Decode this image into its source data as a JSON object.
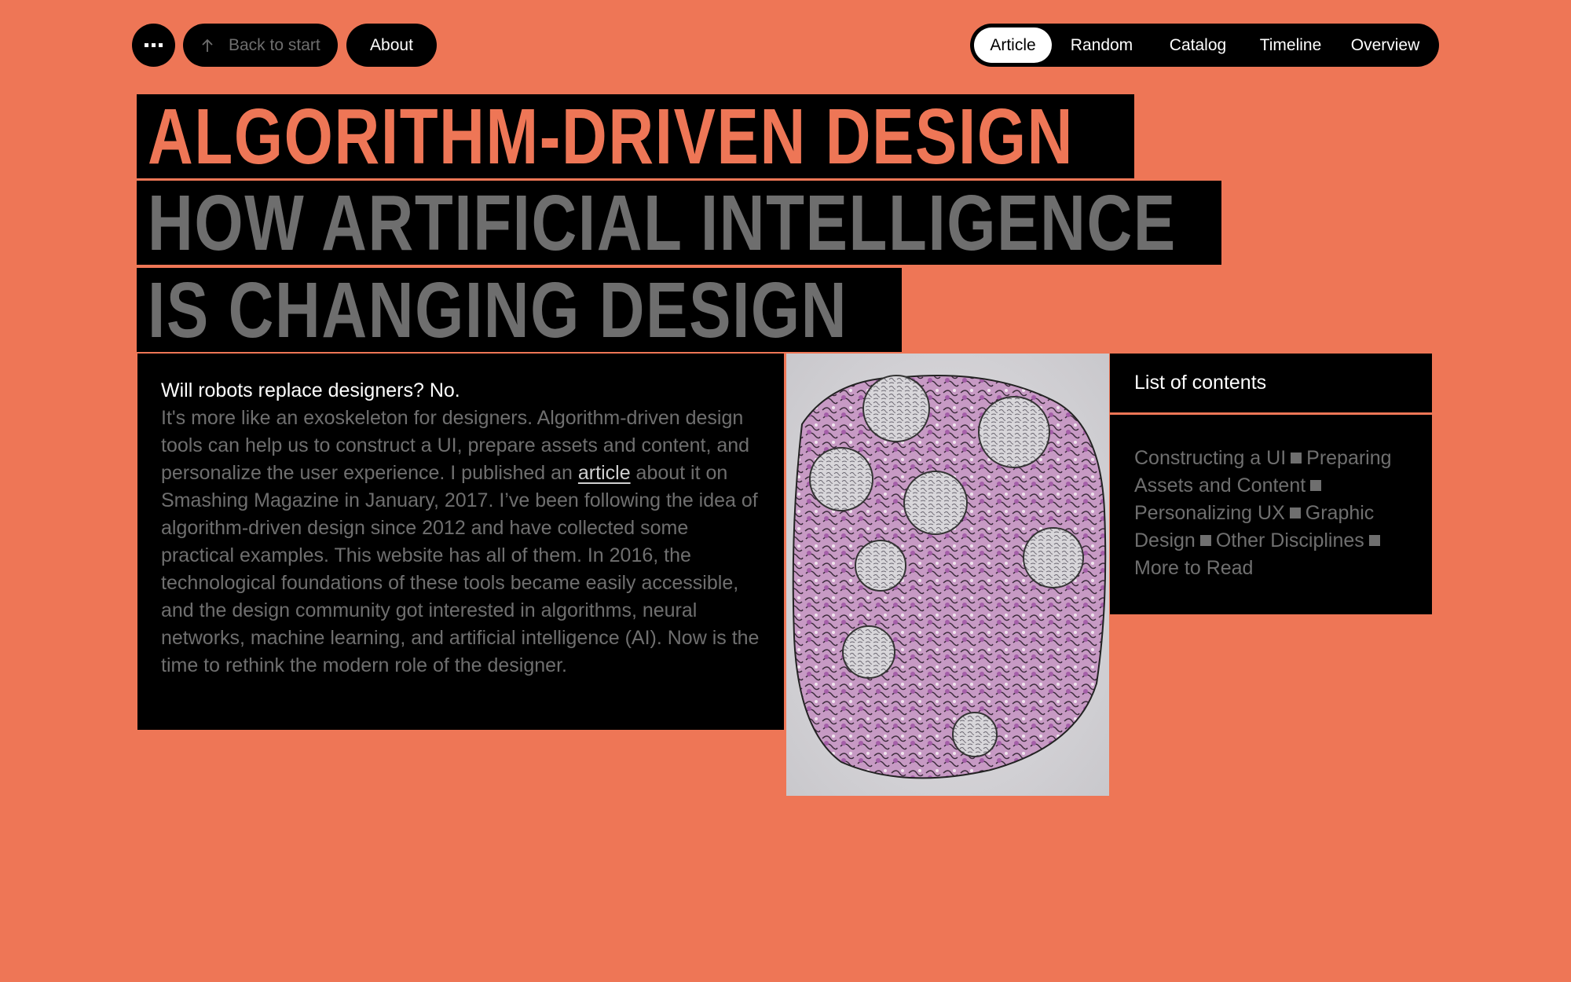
{
  "header": {
    "menu_icon": "more-dots-icon",
    "back_label": "Back to start",
    "back_icon": "arrow-up-icon",
    "about_label": "About",
    "nav": [
      {
        "label": "Article",
        "active": true
      },
      {
        "label": "Random",
        "active": false
      },
      {
        "label": "Catalog",
        "active": false
      },
      {
        "label": "Timeline",
        "active": false
      },
      {
        "label": "Overview",
        "active": false
      }
    ]
  },
  "title": {
    "line1": "ALGORITHM-DRIVEN DESIGN",
    "line2": "HOW ARTIFICIAL INTELLIGENCE",
    "line3": "IS CHANGING DESIGN"
  },
  "intro": {
    "lead": "Will robots replace designers? No.",
    "text_before_link": "It's more like an exoskeleton for designers. Algorithm-driven design tools can help us to construct a UI, prepare assets and content, and personalize the user experience. I published an ",
    "link_label": "article",
    "text_after_link": " about it on Smashing Magazine in January, 2017. I’ve been following the idea of algorithm-driven design since 2012 and have collected some practical examples. This website has all of them. In 2016, the technological foundations of these tools became easily accessible, and the design community got interested in algorithms, neural networks, machine learning, and artificial intelligence (AI). Now is the time to rethink the modern role of the designer."
  },
  "figure": {
    "description": "Algorithmically stylized purple and grey organic cell-like illustration"
  },
  "toc": {
    "heading": "List of contents",
    "items": [
      "Constructing a UI",
      "Preparing Assets and Content",
      "Personalizing UX",
      "Graphic Design",
      "Other Disciplines",
      "More to Read"
    ]
  },
  "colors": {
    "background": "#ee7656",
    "panel": "#000000",
    "muted_text": "#6f6f6f",
    "accent": "#ee7656"
  }
}
